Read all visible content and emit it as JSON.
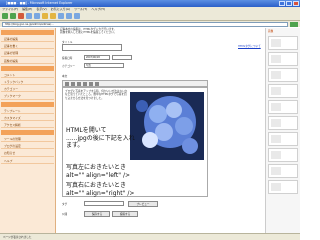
{
  "window": {
    "title": "[■■■ - ■■] - Microsoft Internet Explorer"
  },
  "menu": [
    "ファイル(F)",
    "編集(E)",
    "表示(V)",
    "お気に入り(A)",
    "ツール(T)",
    "ヘルプ(H)"
  ],
  "address": {
    "value": "http://blog.goo.ne.jp/admin/entries/..."
  },
  "sidebar": {
    "items": [
      "記事の編集",
      "記事を書く",
      "記事の管理",
      "画像の編集",
      "コメント",
      "トラックバック",
      "カテゴリー",
      "ブックマーク",
      "テンプレート",
      "カスタマイズ",
      "アクセス解析",
      "ツールの管理",
      "ブログの設定",
      "お知らせ",
      "ヘルプ"
    ]
  },
  "notice": {
    "line1": "記事本文の編集は、HTMLタグ入力で行います。",
    "line2": "画像を挿入した後にHTMLを編集してください。"
  },
  "form": {
    "title_label": "タイトル",
    "help_link": "HTMLタグについて",
    "date_label": "投稿日時",
    "date_value": "2007/06/18",
    "category_label": "カテゴリー",
    "category_value": "写真",
    "body_label": "本文"
  },
  "editor": {
    "intro": "ブログに写真をアップする時、何かいい方法はないかなと思っていたところ。簡単なHTMLタグで写真を回り込ませる方法を見つけました。",
    "line1": "HTMLを開いて",
    "line2": "......jpgの後に下記を入れます。",
    "line3": "写真左におきたいとき",
    "line4": "alt=\"\" align=\"left\" />",
    "line5": "写真右におきたいとき",
    "line6": "alt=\"\" align=\"right\" />"
  },
  "footer": {
    "tag_label": "タグ",
    "preview_button": "プレビュー",
    "save_button": "保存する",
    "publish_label": "公開",
    "publish_button": "投稿する"
  },
  "rightpanel": {
    "label": "画像"
  },
  "status": {
    "text": "ページが表示されました"
  },
  "colors": {
    "accent": "#f3a25a",
    "sidebar_bg": "#fbe9d6",
    "titlebar": "#2a5fc8"
  }
}
